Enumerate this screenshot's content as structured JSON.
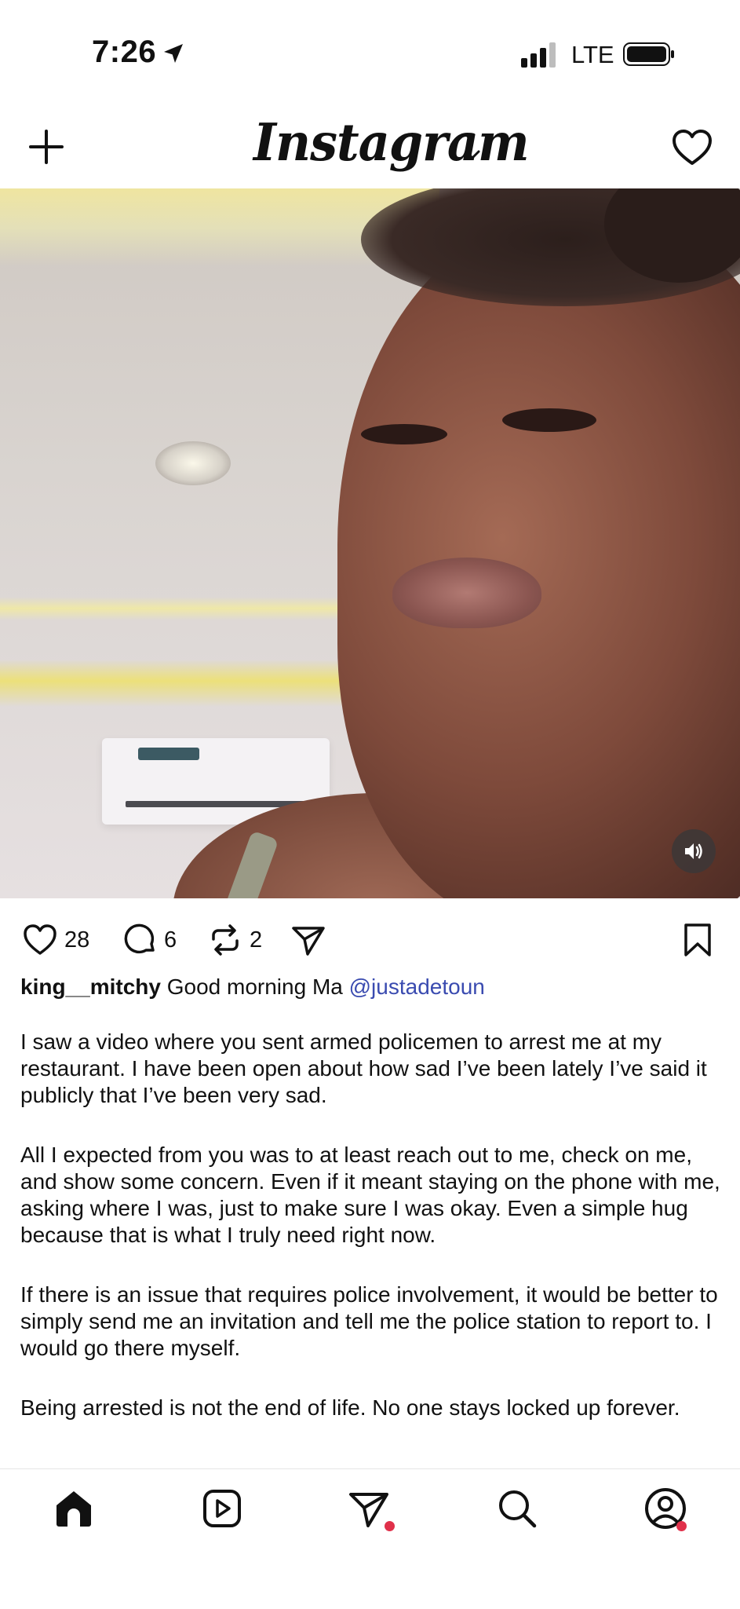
{
  "status_bar": {
    "time": "7:26",
    "network": "LTE"
  },
  "header": {
    "logo": "Instagram"
  },
  "post": {
    "likes": "28",
    "comments": "6",
    "reposts": "2",
    "username": "king__mitchy",
    "caption_lead": "Good morning Ma",
    "mention": "@justadetoun",
    "paragraphs": [
      "I saw a video where you sent armed policemen to arrest me at my restaurant. I have been open about how sad I’ve been lately I’ve said it publicly that I’ve been very sad.",
      "All I expected from you was to at least reach out to me, check on me, and show some concern. Even if it meant staying on the phone with me, asking where I was, just to make sure I was okay. Even a simple hug  because that is what I truly need right now.",
      "If there is an issue that requires police involvement, it would be better to simply send me an invitation and tell me the police station to report to. I would go there myself.",
      "Being arrested is not the end of life. No one stays locked up forever."
    ]
  },
  "icons": {
    "status": [
      "location-arrow-icon",
      "signal-icon",
      "battery-icon"
    ],
    "header": [
      "plus-icon",
      "chevron-down-icon",
      "heart-icon"
    ],
    "actions": [
      "like-icon",
      "comment-icon",
      "repost-icon",
      "share-icon",
      "bookmark-icon"
    ],
    "media": [
      "speaker-icon"
    ],
    "nav": [
      "home-icon",
      "reels-icon",
      "messages-icon",
      "search-icon",
      "profile-icon"
    ]
  },
  "colors": {
    "mention": "#3a4bb0",
    "notification_dot": "#e0304a"
  }
}
